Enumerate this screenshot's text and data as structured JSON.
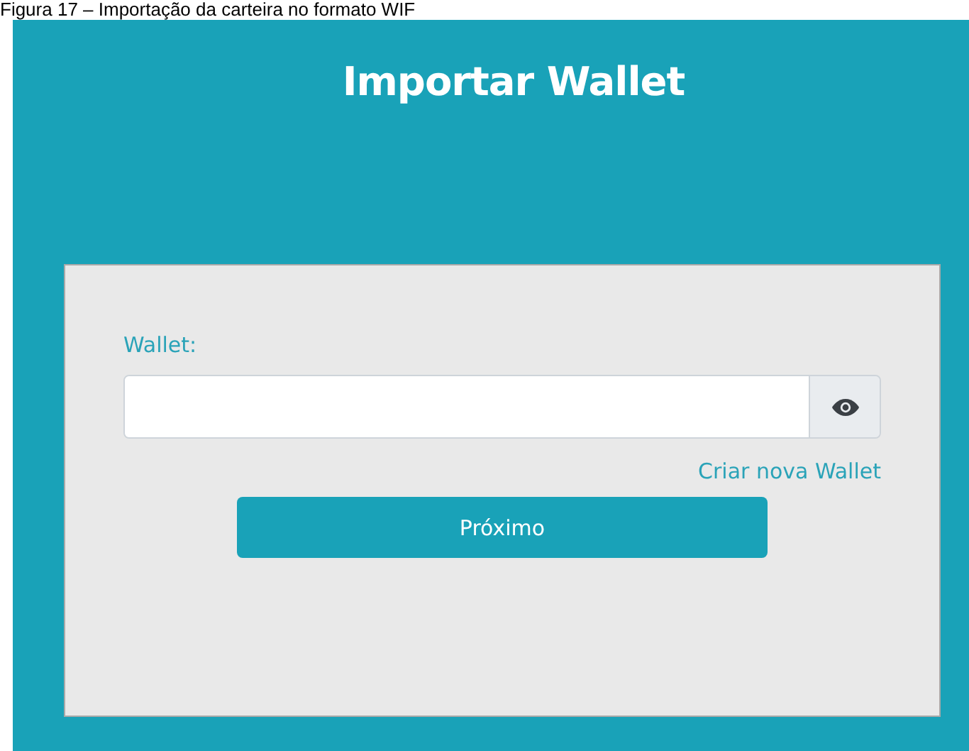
{
  "caption": "Figura 17 – Importação da carteira no formato WIF",
  "title": "Importar Wallet",
  "form": {
    "label": "Wallet:",
    "input": {
      "masked": true
    },
    "link": "Criar nova Wallet",
    "button": "Próximo"
  }
}
